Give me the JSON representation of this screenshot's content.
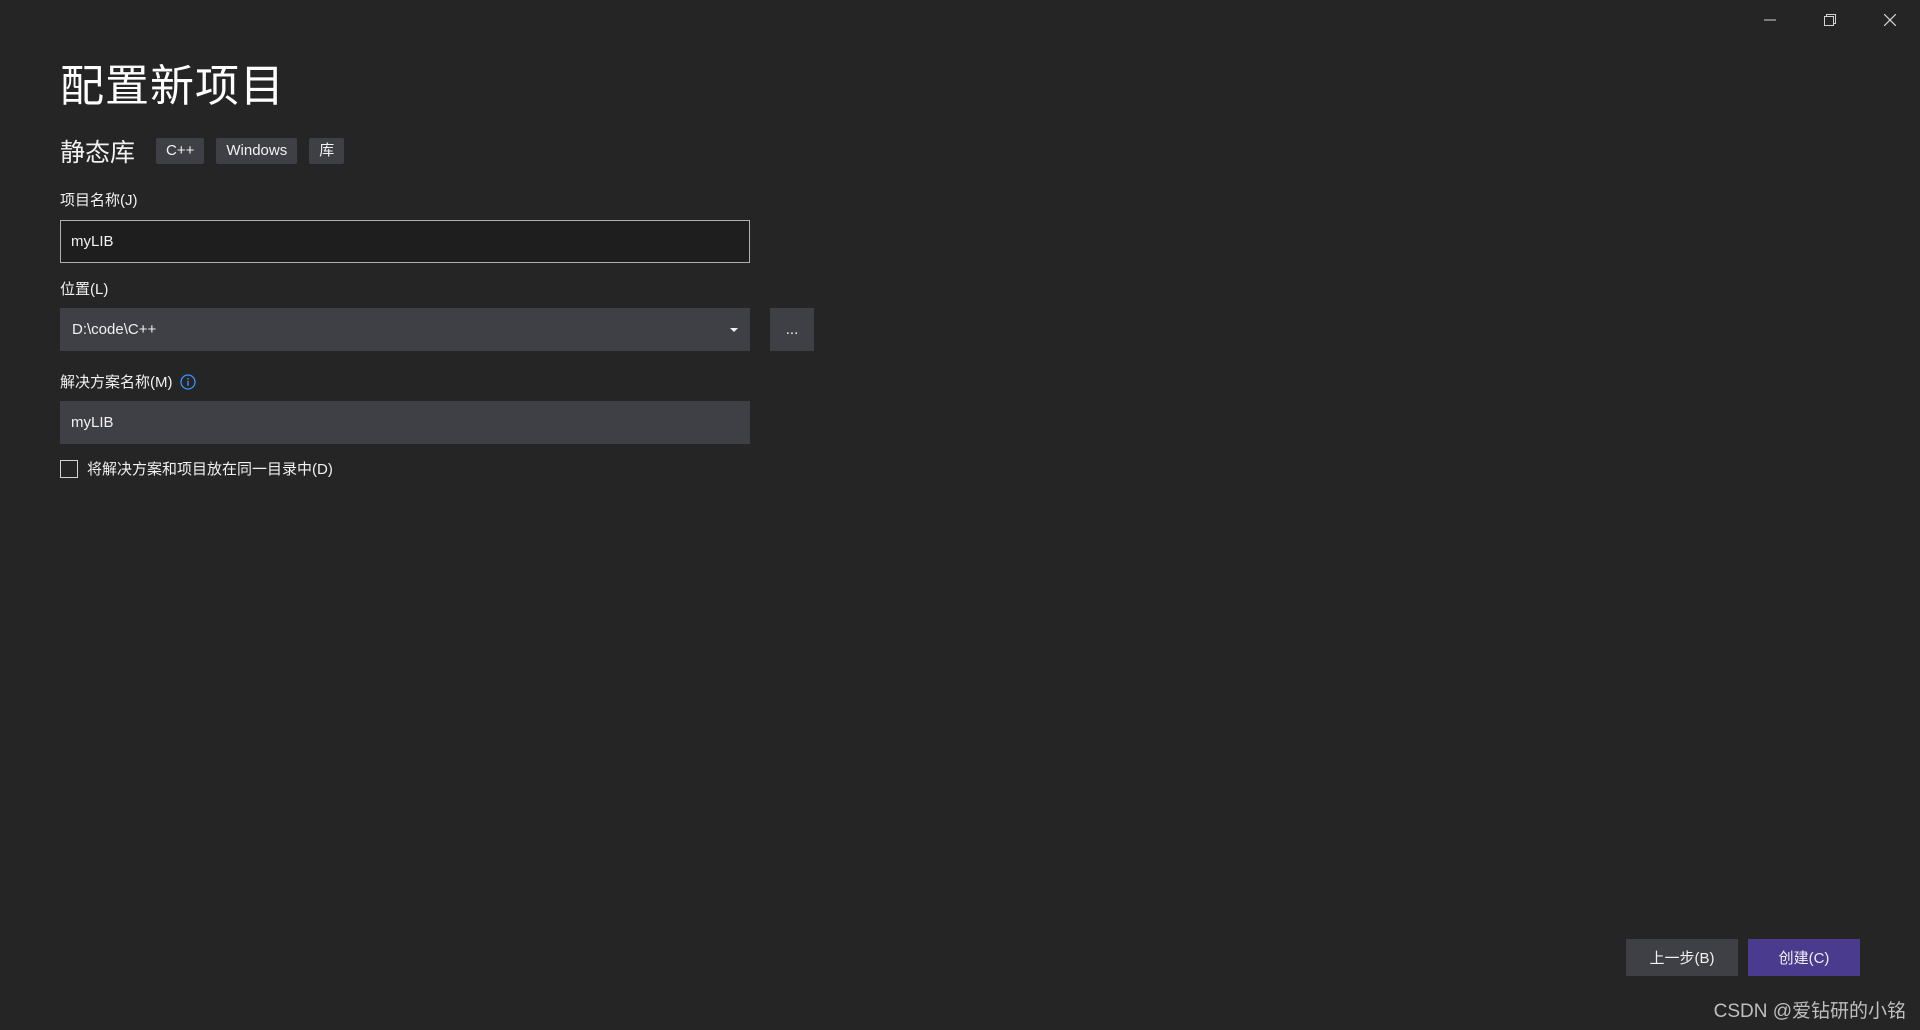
{
  "window": {
    "title": "配置新项目",
    "controls": [
      "minimize-icon",
      "restore-icon",
      "close-icon"
    ]
  },
  "project_template": {
    "name": "静态库",
    "tags": [
      "C++",
      "Windows",
      "库"
    ]
  },
  "form": {
    "project_name": {
      "label": "项目名称(J)",
      "value": "myLIB"
    },
    "location": {
      "label": "位置(L)",
      "value": "D:\\code\\C++",
      "browse_label": "..."
    },
    "solution_name": {
      "label": "解决方案名称(M)",
      "value": "myLIB",
      "info_icon": "info-icon"
    },
    "same_directory": {
      "label": "将解决方案和项目放在同一目录中(D)",
      "checked": false
    }
  },
  "footer": {
    "back_label": "上一步(B)",
    "create_label": "创建(C)"
  },
  "watermark": "CSDN @爱钻研的小铭",
  "colors": {
    "background": "#252526",
    "input_dark": "#1e1e1e",
    "control_gray": "#3f3f46",
    "accent_purple": "#4b3b8f",
    "info_blue": "#3794ff"
  }
}
